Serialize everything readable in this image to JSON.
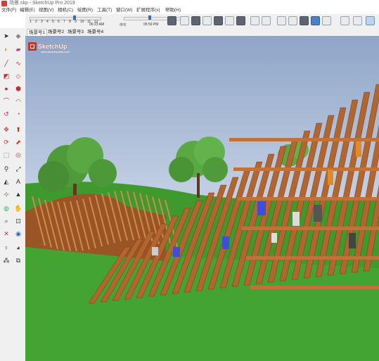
{
  "window": {
    "title": "场景.skp - SketchUp Pro 2019"
  },
  "menu": [
    "文件(F)",
    "编辑(E)",
    "视图(V)",
    "相机(C)",
    "绘图(R)",
    "工具(T)",
    "窗口(W)",
    "扩展程序(x)",
    "帮助(H)"
  ],
  "shadow_settings": {
    "months": [
      "1",
      "2",
      "3",
      "4",
      "5",
      "6",
      "7",
      "8",
      "9",
      "10",
      "11",
      "12"
    ],
    "sunrise": "06:23 AM",
    "noon": "中午",
    "sunset": "05:59 PM",
    "month_position": 0.62,
    "time_position": 0.4
  },
  "scene_tabs": [
    "场景号1",
    "场景号2",
    "场景号3",
    "场景号4"
  ],
  "active_tab": 0,
  "logo": {
    "brand": "SketchUp",
    "url": "www.sketchupbbs.com"
  },
  "colors": {
    "sky_top": "#8fa5c8",
    "sky_bottom": "#c3d0e4",
    "grass": "#3e9a2c",
    "wood": "#b2652e",
    "book_blue": "#3b4fd8"
  }
}
